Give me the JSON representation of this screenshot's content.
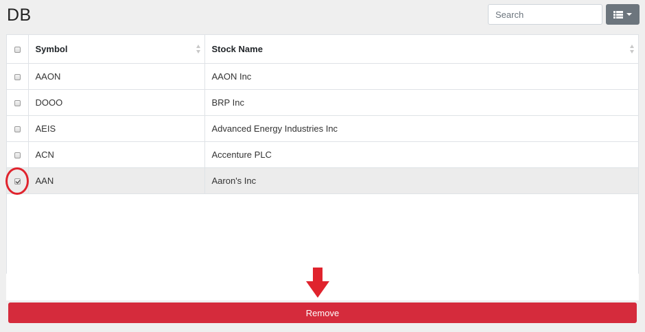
{
  "header": {
    "title": "DB",
    "search_placeholder": "Search",
    "columns_icon": "th-list-icon"
  },
  "table": {
    "columns": [
      "Symbol",
      "Stock Name"
    ],
    "rows": [
      {
        "symbol": "AAON",
        "name": "AAON Inc",
        "checked": false
      },
      {
        "symbol": "DOOO",
        "name": "BRP Inc",
        "checked": false
      },
      {
        "symbol": "AEIS",
        "name": "Advanced Energy Industries Inc",
        "checked": false
      },
      {
        "symbol": "ACN",
        "name": "Accenture PLC",
        "checked": false
      },
      {
        "symbol": "AAN",
        "name": "Aaron's Inc",
        "checked": true
      }
    ]
  },
  "annotations": {
    "highlight_color": "#e0232d",
    "circle_target": "AAN row checkbox",
    "arrow_target": "remove-button"
  },
  "actions": {
    "remove_label": "Remove"
  },
  "colors": {
    "remove_button": "#d52b3c",
    "columns_button": "#6c757d",
    "selected_row": "#ececec"
  }
}
